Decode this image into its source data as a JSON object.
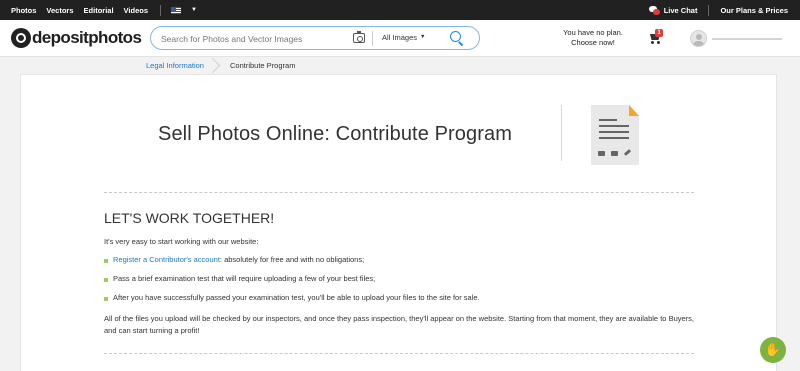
{
  "topbar": {
    "nav": [
      "Photos",
      "Vectors",
      "Editorial",
      "Videos"
    ],
    "live_chat": "Live Chat",
    "plans": "Our Plans & Prices"
  },
  "header": {
    "logo": "depositphotos",
    "search_placeholder": "Search for Photos and Vector Images",
    "filter": "All Images",
    "plan_line1": "You have no plan.",
    "plan_line2": "Choose now!",
    "cart_count": "1"
  },
  "breadcrumb": {
    "parent": "Legal Information",
    "current": "Contribute Program"
  },
  "content": {
    "title": "Sell Photos Online: Contribute Program",
    "heading": "LET'S WORK TOGETHER!",
    "intro": "It's very easy to start working with our website:",
    "steps": [
      {
        "link": "Register a Contributor's account",
        "text": ": absolutely for free and with no obligations;"
      },
      {
        "link": "",
        "text": "Pass a brief examination test that will require uploading a few of your best files;"
      },
      {
        "link": "",
        "text": "After you have successfully passed your examination test, you'll be able to upload your files to the site for sale."
      }
    ],
    "paragraph": "All of the files you upload will be checked by our inspectors, and once they pass inspection, they'll appear on the website. Starting from that moment, they are available to Buyers, and can start turning a profit!"
  },
  "colors": {
    "accent": "#1e76c9",
    "bullet": "#9ccc65",
    "help_button": "#7cb342",
    "badge": "#e53935"
  },
  "icons": [
    "us-flag-icon",
    "live-chat-icon",
    "camera-search-icon",
    "search-icon",
    "cart-icon",
    "avatar-icon",
    "document-icon",
    "hand-help-icon"
  ]
}
